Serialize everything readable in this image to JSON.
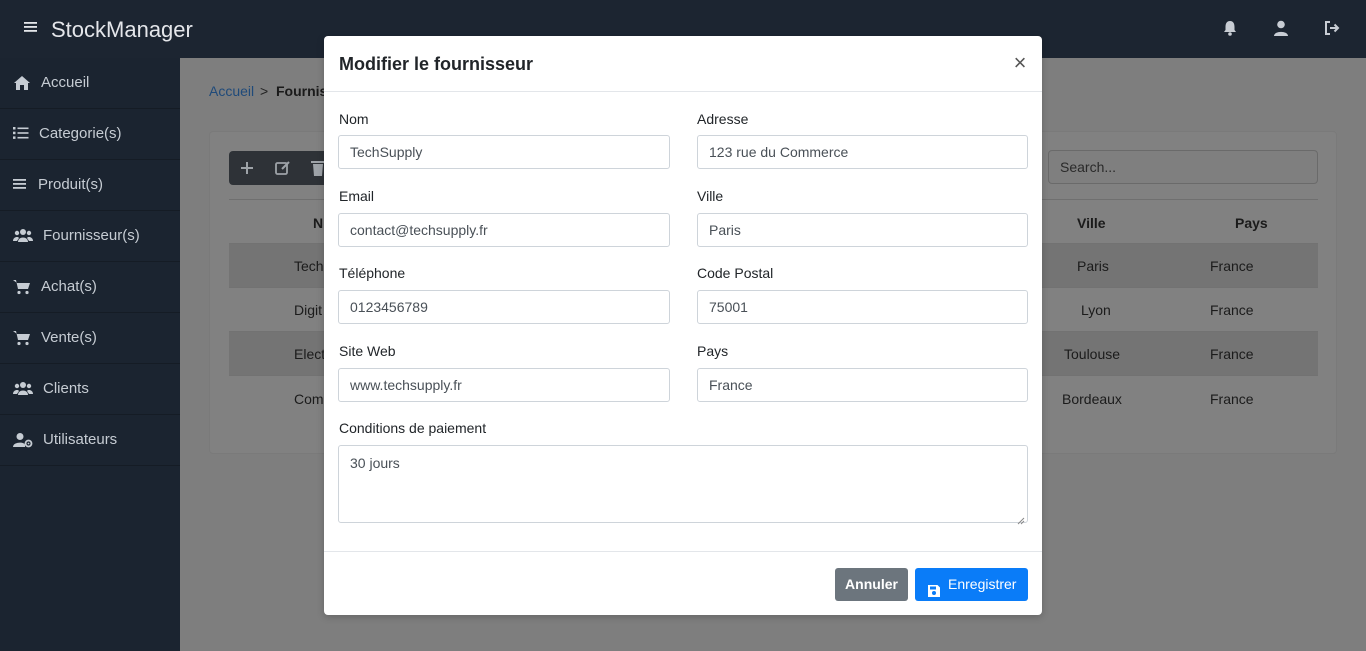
{
  "app": {
    "brand": "StockManager"
  },
  "sidebar": {
    "items": [
      {
        "label": "Accueil",
        "icon": "home-icon"
      },
      {
        "label": "Categorie(s)",
        "icon": "list-icon"
      },
      {
        "label": "Produit(s)",
        "icon": "bars-icon"
      },
      {
        "label": "Fournisseur(s)",
        "icon": "users-icon"
      },
      {
        "label": "Achat(s)",
        "icon": "cart-icon"
      },
      {
        "label": "Vente(s)",
        "icon": "cart-icon"
      },
      {
        "label": "Clients",
        "icon": "users-icon"
      },
      {
        "label": "Utilisateurs",
        "icon": "user-cog-icon"
      }
    ]
  },
  "breadcrumb": {
    "home": "Accueil",
    "separator": ">",
    "current": "Fourniss"
  },
  "table": {
    "search_placeholder": "Search...",
    "headers": [
      "N",
      "Ville",
      "Pays"
    ],
    "rows": [
      {
        "nom": "TechS",
        "ville": "Paris",
        "pays": "France"
      },
      {
        "nom": "Digit",
        "ville": "Lyon",
        "pays": "France"
      },
      {
        "nom": "Elect",
        "ville": "Toulouse",
        "pays": "France"
      },
      {
        "nom": "Com",
        "ville": "Bordeaux",
        "pays": "France"
      }
    ]
  },
  "modal": {
    "title": "Modifier le fournisseur",
    "close": "×",
    "fields": {
      "nom": {
        "label": "Nom",
        "value": "TechSupply"
      },
      "adresse": {
        "label": "Adresse",
        "value": "123 rue du Commerce"
      },
      "email": {
        "label": "Email",
        "value": "contact@techsupply.fr"
      },
      "ville": {
        "label": "Ville",
        "value": "Paris"
      },
      "telephone": {
        "label": "Téléphone",
        "value": "0123456789"
      },
      "code_postal": {
        "label": "Code Postal",
        "value": "75001"
      },
      "site_web": {
        "label": "Site Web",
        "value": "www.techsupply.fr"
      },
      "pays": {
        "label": "Pays",
        "value": "France"
      },
      "conditions": {
        "label": "Conditions de paiement",
        "value": "30 jours"
      }
    },
    "buttons": {
      "cancel": "Annuler",
      "save": "Enregistrer"
    }
  },
  "colors": {
    "topbar": "#1c2531",
    "sidebar": "#1b2430",
    "primary": "#0a7cf8",
    "secondary": "#6c757d"
  }
}
